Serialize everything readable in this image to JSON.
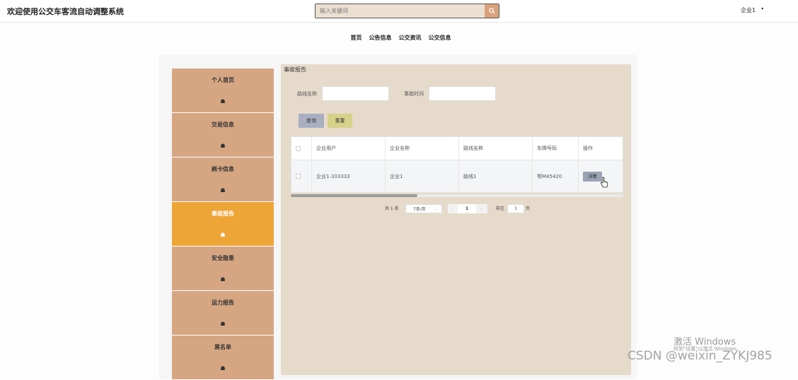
{
  "header": {
    "app_title": "欢迎使用公交车客流自动调整系统",
    "search_placeholder": "输入关键词",
    "user_name": "企业1",
    "user_caret": "▾"
  },
  "nav": {
    "items": [
      "首页",
      "公告信息",
      "公交资讯",
      "公交信息"
    ]
  },
  "sidebar": {
    "items": [
      {
        "label": "个人首页",
        "active": false
      },
      {
        "label": "交易信息",
        "active": false
      },
      {
        "label": "刷卡信息",
        "active": false
      },
      {
        "label": "事故报告",
        "active": true
      },
      {
        "label": "安全隐患",
        "active": false
      },
      {
        "label": "运力报告",
        "active": false
      },
      {
        "label": "黑名单",
        "active": false
      }
    ]
  },
  "main": {
    "title": "事故报告",
    "filters": {
      "route_label": "路线名称",
      "time_label": "事故时间"
    },
    "buttons": {
      "query": "查询",
      "reset": "重置"
    },
    "table": {
      "headers": [
        "企业用户",
        "企业名称",
        "路线名称",
        "车牌号码",
        "操作"
      ],
      "rows": [
        {
          "enterprise_user": "企业1-333333",
          "enterprise_name": "企业1",
          "route_name": "路线1",
          "plate": "鄂M45420",
          "action": "详情"
        }
      ]
    },
    "pagination": {
      "total": "共 1 条",
      "page_size": "7条/页",
      "prev": "‹",
      "current": "1",
      "next": "›",
      "goto_label": "前往",
      "goto_value": "1",
      "page_suffix": "页"
    }
  },
  "watermarks": {
    "activate_windows": "激活 Windows",
    "activate_hint": "转到\"设置\"以激活 Windows。",
    "csdn": "CSDN @weixin_ZYKJ985"
  },
  "colors": {
    "sidebar_bg": "#d6a683",
    "sidebar_active": "#eea538",
    "panel_bg": "#e6dacb",
    "query_btn": "#a9afc1",
    "reset_btn": "#d7d28a",
    "search_btn": "#d9a27e"
  }
}
